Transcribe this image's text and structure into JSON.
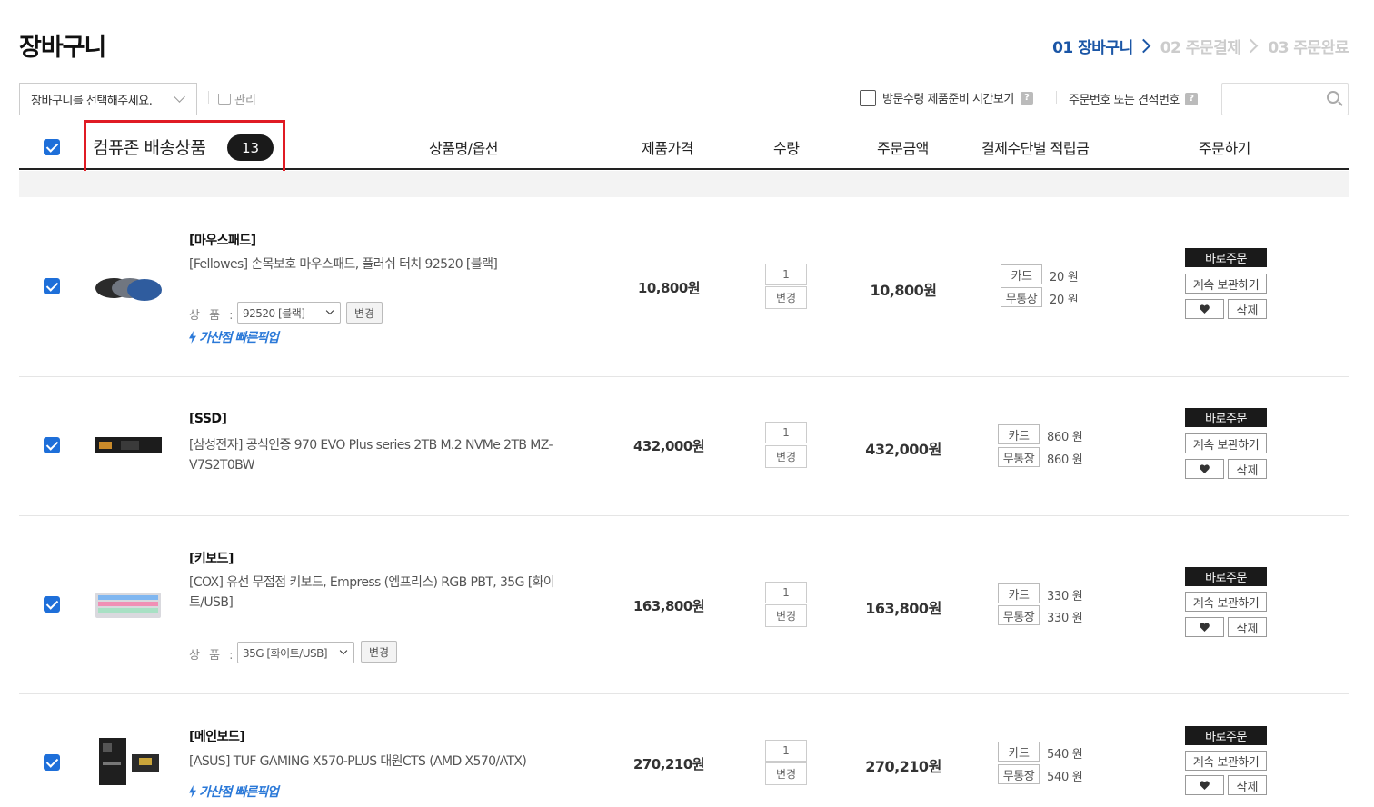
{
  "page": {
    "title": "장바구니",
    "steps": [
      {
        "label": "01 장바구니",
        "active": true
      },
      {
        "label": "02 주문결제",
        "active": false
      },
      {
        "label": "03 주문완료",
        "active": false
      }
    ]
  },
  "toolbar": {
    "cart_select_label": "장바구니를 선택해주세요.",
    "manage_label": "관리",
    "visit_check_label": "방문수령 제품준비 시간보기",
    "order_search_label": "주문번호 또는 견적번호",
    "search_placeholder": ""
  },
  "table": {
    "group_title": "컴퓨존 배송상품",
    "group_count": "13",
    "headers": {
      "name": "상품명/옵션",
      "price": "제품가격",
      "qty": "수량",
      "total": "주문금액",
      "points": "결제수단별 적립금",
      "order": "주문하기"
    }
  },
  "labels": {
    "option_prefix": "상 품 :",
    "change": "변경",
    "card": "카드",
    "bank": "무통장",
    "buy_now": "바로주문",
    "keep": "계속 보관하기",
    "delete": "삭제",
    "pickup": "가산점 빠른픽업"
  },
  "items": [
    {
      "category": "[마우스패드]",
      "name": "[Fellowes] 손목보호 마우스패드, 플러쉬 터치 92520 [블랙]",
      "option": "92520 [블랙]",
      "price": "10,800원",
      "qty": "1",
      "total": "10,800원",
      "card_points": "20 원",
      "bank_points": "20 원",
      "pickup": true
    },
    {
      "category": "[SSD]",
      "name": "[삼성전자] 공식인증 970 EVO Plus series 2TB M.2 NVMe 2TB MZ-V7S2T0BW",
      "option": "",
      "price": "432,000원",
      "qty": "1",
      "total": "432,000원",
      "card_points": "860 원",
      "bank_points": "860 원",
      "pickup": false
    },
    {
      "category": "[키보드]",
      "name": "[COX] 유선 무접점 키보드, Empress (엠프리스) RGB PBT, 35G [화이트/USB]",
      "option": "35G [화이트/USB]",
      "price": "163,800원",
      "qty": "1",
      "total": "163,800원",
      "card_points": "330 원",
      "bank_points": "330 원",
      "pickup": false
    },
    {
      "category": "[메인보드]",
      "name": "[ASUS] TUF GAMING X570-PLUS 대원CTS (AMD X570/ATX)",
      "option": "",
      "price": "270,210원",
      "qty": "1",
      "total": "270,210원",
      "card_points": "540 원",
      "bank_points": "540 원",
      "pickup": true
    }
  ],
  "colors": {
    "accent_blue": "#1b56a6",
    "checkbox_blue": "#1e6fd9",
    "pickup_blue": "#2b79d8",
    "highlight_red": "#e01b24"
  }
}
